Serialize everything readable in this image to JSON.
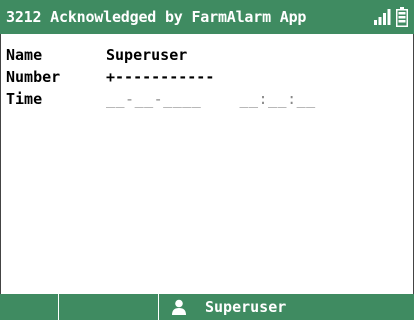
{
  "header": {
    "title": "3212 Acknowledged by FarmAlarm App",
    "icons": [
      "signal-icon",
      "battery-icon"
    ],
    "background": "#3f8b61"
  },
  "details": {
    "name_label": "Name",
    "name_value": "Superuser",
    "number_label": "Number",
    "number_value": "+-----------",
    "time_label": "Time",
    "time_date": "__-__-____",
    "time_time": "__:__:__"
  },
  "footer": {
    "user_icon": "user-icon",
    "user_label": "Superuser"
  }
}
